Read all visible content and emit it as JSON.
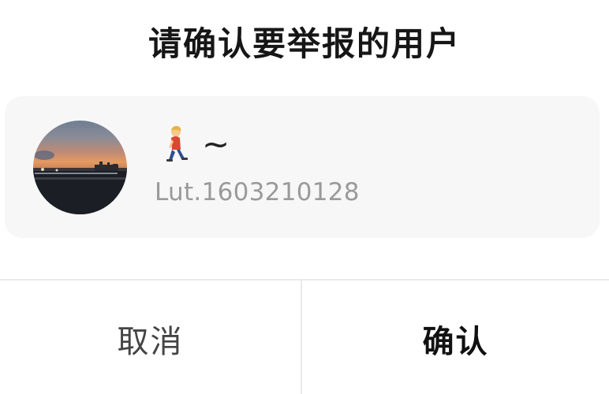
{
  "dialog": {
    "title": "请确认要举报的用户"
  },
  "user": {
    "display_name_emoji": "walking-person-emoji",
    "display_name_text": "~",
    "id": "Lut.1603210128",
    "avatar": "sunset-pier-photo"
  },
  "buttons": {
    "cancel_label": "取消",
    "confirm_label": "确认"
  },
  "colors": {
    "background": "#ffffff",
    "card_background": "#f7f7f8",
    "divider": "#eaeaea",
    "secondary_text": "#9a9a9a"
  }
}
